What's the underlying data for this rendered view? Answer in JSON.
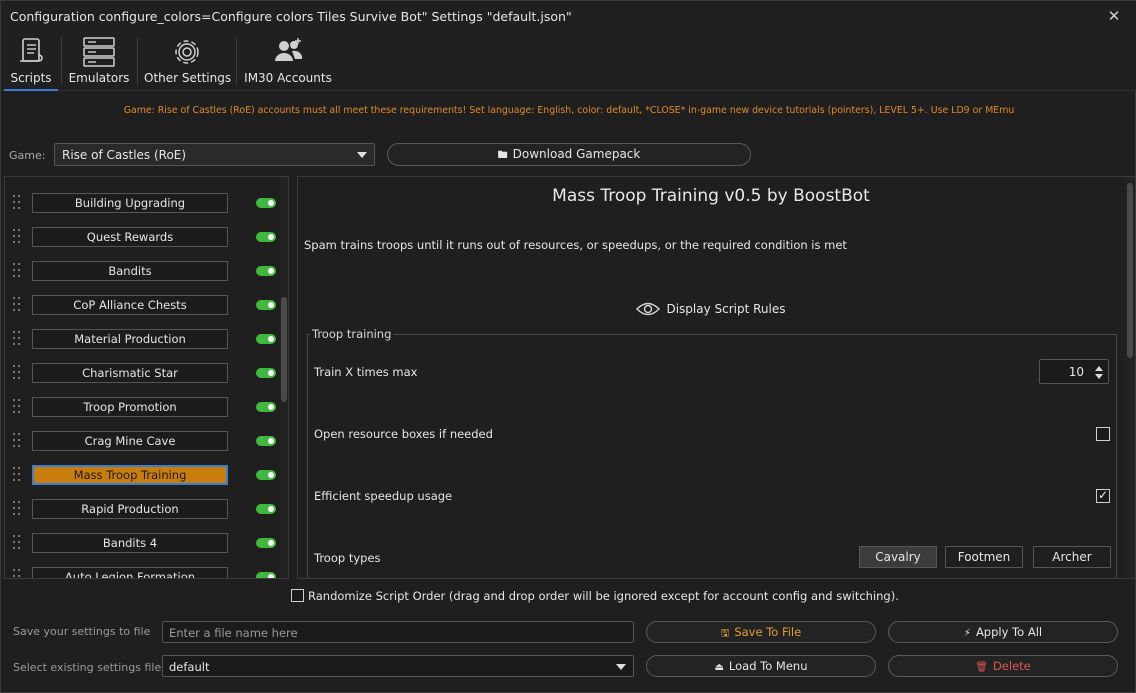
{
  "window": {
    "title": "Configuration configure_colors=Configure colors Tiles Survive Bot\" Settings \"default.json\"",
    "close_icon": "close-icon"
  },
  "tabs": [
    {
      "label": "Scripts",
      "icon": "scroll-icon",
      "active": true
    },
    {
      "label": "Emulators",
      "icon": "server-icon",
      "active": false
    },
    {
      "label": "Other Settings",
      "icon": "gear-icon",
      "active": false
    },
    {
      "label": "IM30 Accounts",
      "icon": "users-icon",
      "active": false
    }
  ],
  "notice": "Game: Rise of Castles (RoE) accounts must all meet these requirements! Set language: English, color: default, *CLOSE* in-game new device tutorials (pointers), LEVEL 5+. Use LD9 or MEmu",
  "game": {
    "label": "Game:",
    "selected": "Rise of Castles (RoE)",
    "download_label": "Download Gamepack"
  },
  "scripts": [
    {
      "label": "Building Upgrading",
      "enabled": true,
      "selected": false
    },
    {
      "label": "Quest Rewards",
      "enabled": true,
      "selected": false
    },
    {
      "label": "Bandits",
      "enabled": true,
      "selected": false
    },
    {
      "label": "CoP Alliance Chests",
      "enabled": true,
      "selected": false
    },
    {
      "label": "Material Production",
      "enabled": true,
      "selected": false
    },
    {
      "label": "Charismatic Star",
      "enabled": true,
      "selected": false
    },
    {
      "label": "Troop Promotion",
      "enabled": true,
      "selected": false
    },
    {
      "label": "Crag Mine Cave",
      "enabled": true,
      "selected": false
    },
    {
      "label": "Mass Troop Training",
      "enabled": true,
      "selected": true
    },
    {
      "label": "Rapid Production",
      "enabled": true,
      "selected": false
    },
    {
      "label": "Bandits 4",
      "enabled": true,
      "selected": false
    },
    {
      "label": "Auto Legion Formation",
      "enabled": true,
      "selected": false
    }
  ],
  "detail": {
    "title": "Mass Troop Training v0.5 by BoostBot",
    "description": "Spam trains troops until it runs out of resources, or speedups, or the required condition is met",
    "rules_label": "Display Script Rules",
    "group_title": "Troop training",
    "train_label": "Train X times max",
    "train_value": "10",
    "open_boxes_label": "Open resource boxes if needed",
    "open_boxes_checked": false,
    "speedup_label": "Efficient speedup usage",
    "speedup_checked": true,
    "troop_types_label": "Troop types",
    "troop_types": [
      {
        "label": "Cavalry",
        "selected": true
      },
      {
        "label": "Footmen",
        "selected": false
      },
      {
        "label": "Archer",
        "selected": false
      }
    ]
  },
  "randomize": {
    "label": "Randomize Script Order (drag and drop order will be ignored except for account config and switching).",
    "checked": false
  },
  "bottom": {
    "save_label": "Save your settings to file",
    "save_placeholder": "Enter a file name here",
    "save_button": "Save To File",
    "apply_button": "Apply To All",
    "load_label": "Select existing settings file",
    "load_selected": "default",
    "load_button": "Load To Menu",
    "delete_button": "Delete"
  },
  "colors": {
    "accent": "#3a7bd5",
    "selected_script": "#c97d0c",
    "notice": "#e08a2a",
    "toggle_on": "#3fba3f",
    "save_button_text": "#e0a030",
    "delete_button_text": "#e05555"
  }
}
